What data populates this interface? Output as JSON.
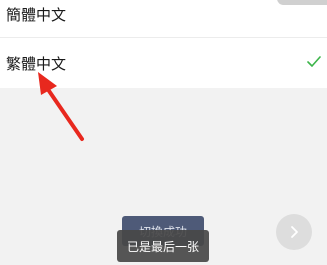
{
  "language_list": {
    "items": [
      {
        "label": "簡體中文",
        "selected": false
      },
      {
        "label": "繁體中文",
        "selected": true
      }
    ]
  },
  "icons": {
    "check": "check-icon",
    "arrow": "red-arrow-annotation",
    "next": "chevron-right-icon"
  },
  "toasts": {
    "switch_success": "切換成功",
    "last_page": "已是最后一张"
  },
  "colors": {
    "check": "#3cb54a",
    "arrow": "#e8281e",
    "success_toast": "#4e5a78",
    "last_toast": "#484848"
  }
}
